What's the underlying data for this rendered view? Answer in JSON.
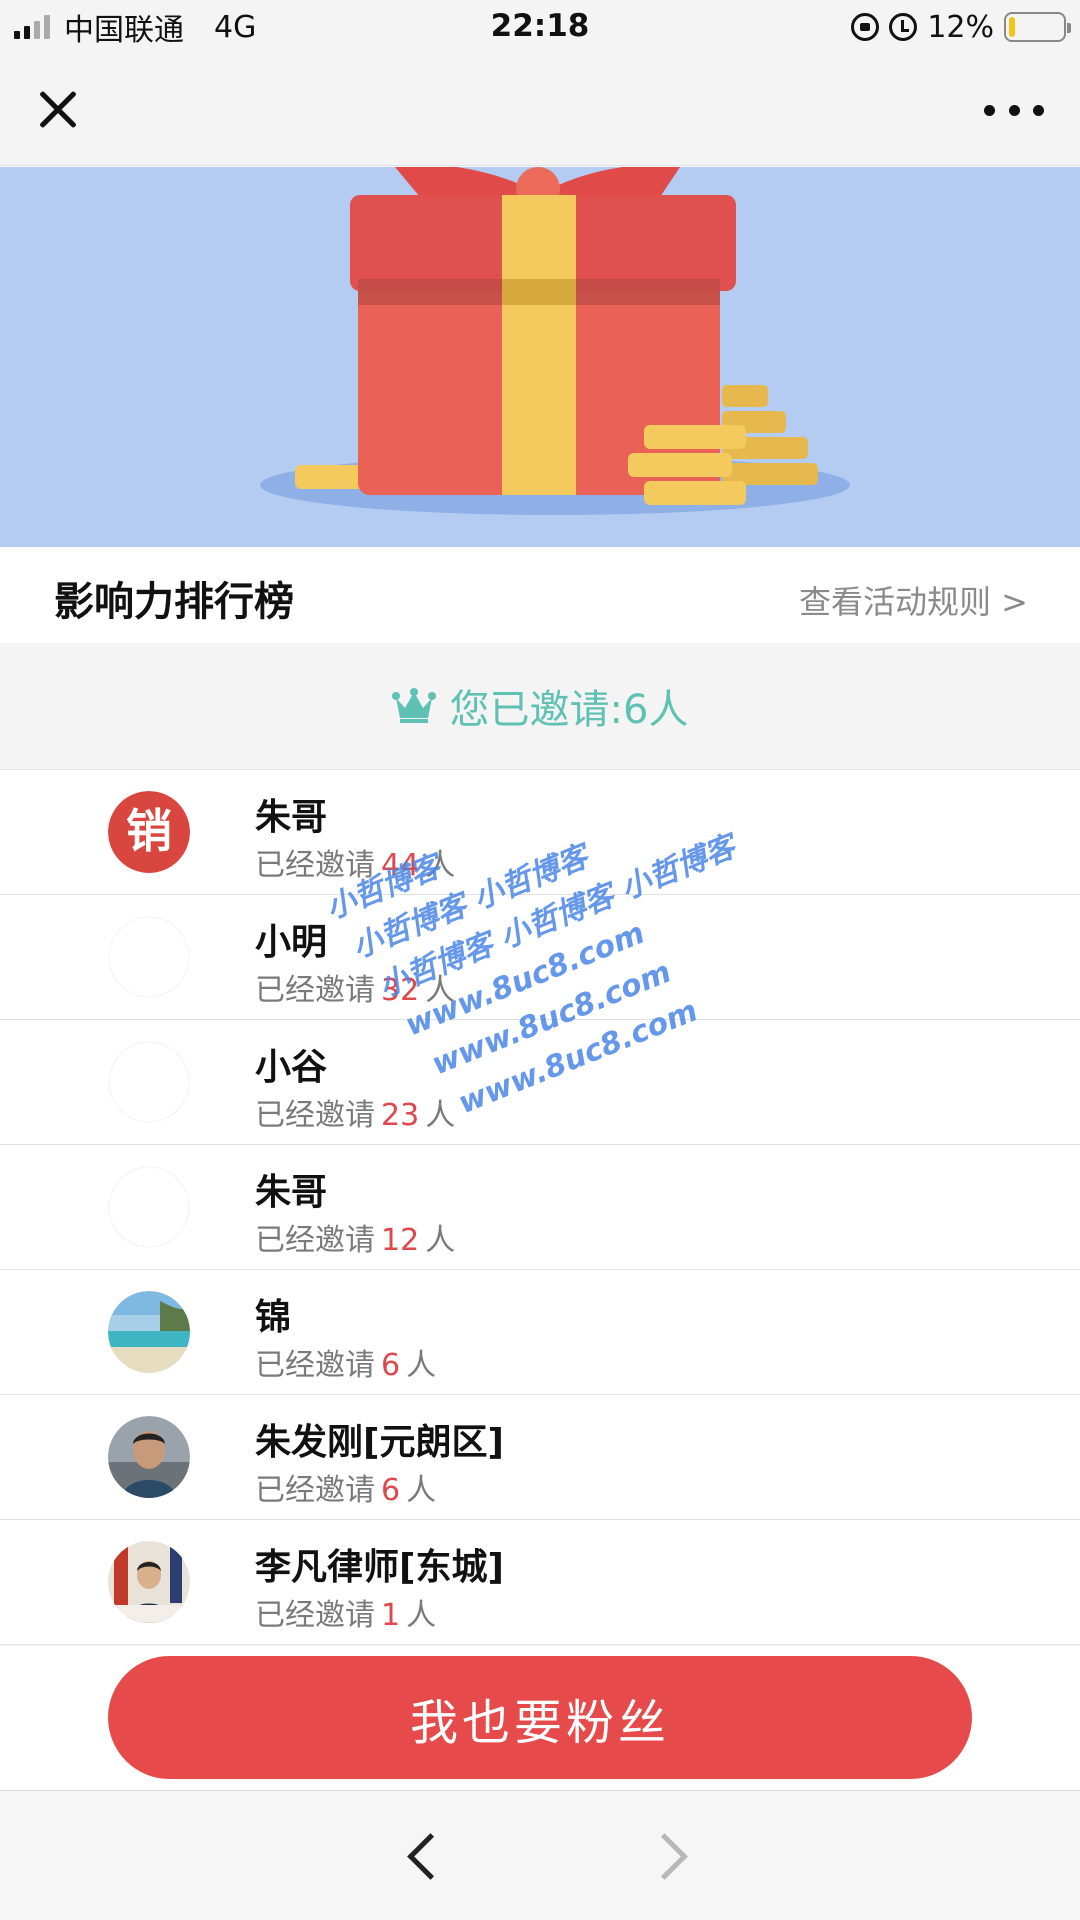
{
  "status_bar": {
    "carrier": "中国联通",
    "network": "4G",
    "time": "22:18",
    "battery": "12%",
    "battery_level": 0.12
  },
  "banner": {
    "background_color": "#b5ccf2",
    "image": "gift-box-with-coins"
  },
  "leaderboard": {
    "title": "影响力排行榜",
    "rules_link": "查看活动规则 >",
    "invited_summary": "您已邀请:6人",
    "invited_icon": "crown-icon",
    "invite_prefix": "已经邀请",
    "invite_unit": "人",
    "rows": [
      {
        "name": "朱哥",
        "count": "44",
        "avatar": "sales-logo-avatar"
      },
      {
        "name": "小明",
        "count": "32",
        "avatar": "blank-avatar"
      },
      {
        "name": "小谷",
        "count": "23",
        "avatar": "blank-avatar"
      },
      {
        "name": "朱哥",
        "count": "12",
        "avatar": "blank-avatar"
      },
      {
        "name": "锦",
        "count": "6",
        "avatar": "beach-photo-avatar"
      },
      {
        "name": "朱发刚[元朗区]",
        "count": "6",
        "avatar": "man-photo-avatar"
      },
      {
        "name": "李凡律师[东城]",
        "count": "1",
        "avatar": "lawyer-photo-avatar"
      }
    ]
  },
  "cta": {
    "label": "我也要粉丝",
    "color": "#e64a4a"
  },
  "watermark": {
    "lines": [
      "小哲博客",
      "小哲博客 小哲博客",
      "小哲博客 小哲博客 小哲博客",
      "www.8uc8.com",
      "www.8uc8.com",
      "www.8uc8.com"
    ]
  },
  "colors": {
    "accent_teal": "#5ec1b4",
    "count_red": "#e0474a"
  }
}
